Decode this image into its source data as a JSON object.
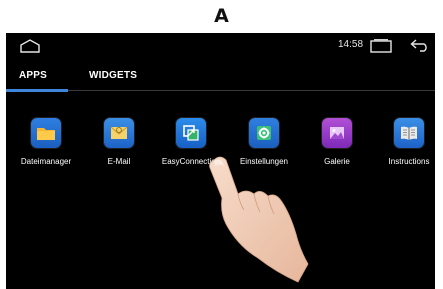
{
  "figure_label": "A",
  "status_bar": {
    "time": "14:58"
  },
  "tabs": [
    {
      "label": "APPS",
      "active": true
    },
    {
      "label": "WIDGETS",
      "active": false
    }
  ],
  "apps": [
    {
      "label": "Dateimanager",
      "icon": "folder-icon"
    },
    {
      "label": "E-Mail",
      "icon": "mail-icon"
    },
    {
      "label": "EasyConnection",
      "icon": "easyconnection-icon"
    },
    {
      "label": "Einstellungen",
      "icon": "gear-icon"
    },
    {
      "label": "Galerie",
      "icon": "gallery-icon"
    },
    {
      "label": "Instructions",
      "icon": "book-icon"
    }
  ],
  "colors": {
    "tab_indicator": "#3f86d9",
    "screen_bg": "#000000"
  }
}
